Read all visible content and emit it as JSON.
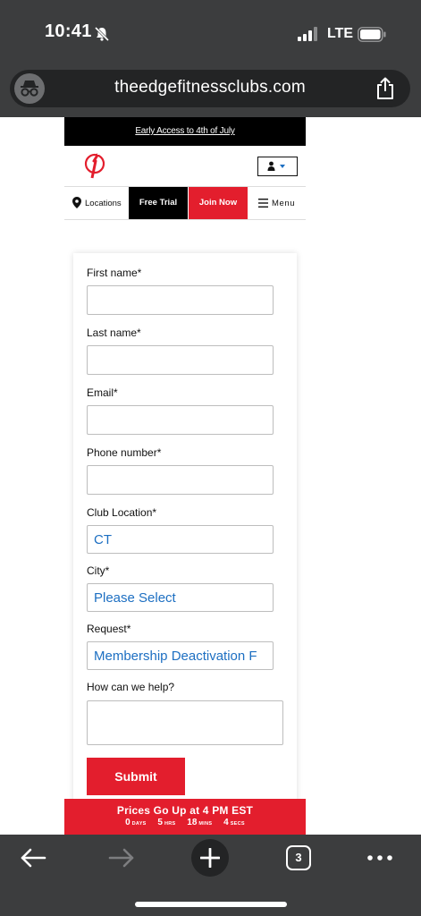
{
  "status_bar": {
    "time": "10:41",
    "network": "LTE"
  },
  "browser": {
    "url": "theedgefitnessclubs.com"
  },
  "site": {
    "promo_banner": "Early Access to 4th of July",
    "nav": {
      "locations": "Locations",
      "free_trial": "Free Trial",
      "join_now": "Join Now",
      "menu": "Menu"
    }
  },
  "form": {
    "first_name_label": "First name*",
    "last_name_label": "Last name*",
    "email_label": "Email*",
    "phone_label": "Phone number*",
    "club_location_label": "Club Location*",
    "club_location_value": "CT",
    "city_label": "City*",
    "city_value": "Please Select",
    "request_label": "Request*",
    "request_value": "Membership Deactivation F",
    "help_label": "How can we help?",
    "submit_label": "Submit"
  },
  "countdown": {
    "title": "Prices Go Up at 4 PM EST",
    "units": [
      {
        "value": "0",
        "label": "DAYS"
      },
      {
        "value": "5",
        "label": "HRS"
      },
      {
        "value": "18",
        "label": "MINS"
      },
      {
        "value": "4",
        "label": "SECS"
      }
    ]
  },
  "toolbar": {
    "tab_count": "3"
  },
  "colors": {
    "brand_red": "#e31e2d",
    "link_blue": "#1d6fc2",
    "chrome_gray": "#3c3d3e"
  },
  "icons": [
    "bell-slash-icon",
    "signal-icon",
    "battery-icon",
    "incognito-icon",
    "share-icon",
    "edge-logo-icon",
    "user-icon",
    "caret-down-icon",
    "location-pin-icon",
    "hamburger-icon",
    "back-arrow-icon",
    "forward-arrow-icon",
    "plus-icon",
    "more-icon"
  ]
}
